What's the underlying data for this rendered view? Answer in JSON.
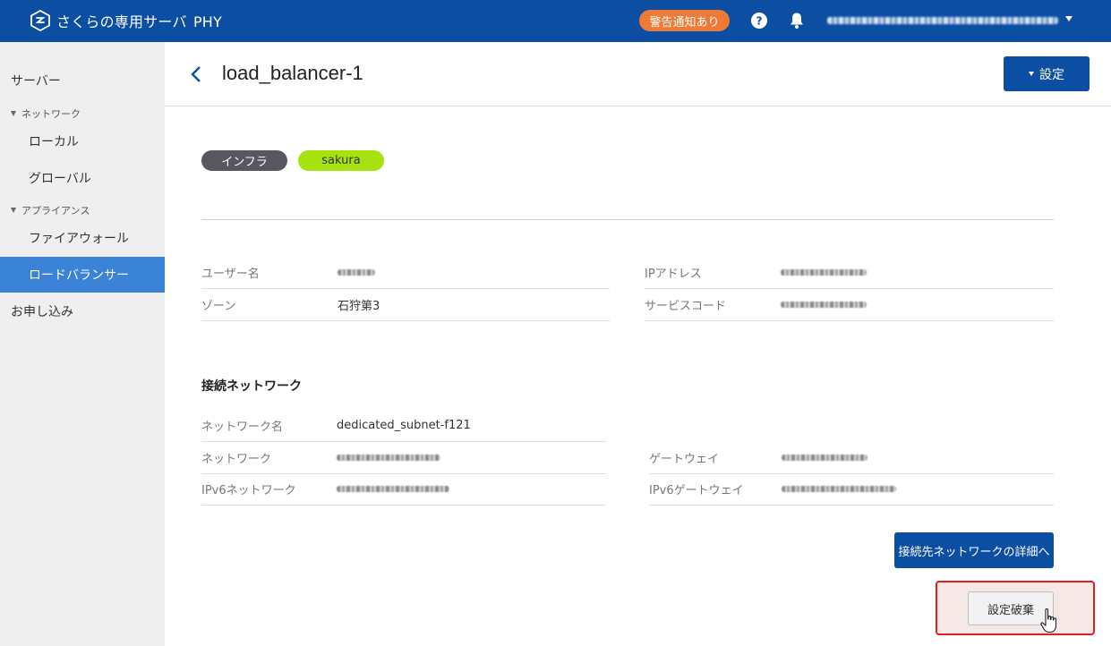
{
  "topbar": {
    "brand": "さくらの専用サーバ",
    "brand_suffix": "PHY",
    "alert_badge": "警告通知あり",
    "icons": [
      "help-icon",
      "bell-icon",
      "caret-down-icon"
    ],
    "colors": {
      "bar": "#0b4ea2",
      "badge": "#ef7a36"
    }
  },
  "sidebar": {
    "server": "サーバー",
    "network_group": "ネットワーク",
    "local": "ローカル",
    "global": "グローバル",
    "appliance_group": "アプライアンス",
    "firewall": "ファイアウォール",
    "load_balancer": "ロードバランサー",
    "apply": "お申し込み",
    "active_color": "#3b83d6"
  },
  "header": {
    "title": "load_balancer-1",
    "settings_button": "設定"
  },
  "tags": {
    "infra": "インフラ",
    "sakura": "sakura",
    "colors": {
      "infra": "#5a5660",
      "sakura": "#a6e20e"
    }
  },
  "info": {
    "username_label": "ユーザー名",
    "zone_label": "ゾーン",
    "zone_value": "石狩第3",
    "ip_label": "IPアドレス",
    "service_code_label": "サービスコード"
  },
  "network": {
    "section_title": "接続ネットワーク",
    "name_label": "ネットワーク名",
    "name_value": "dedicated_subnet-f121",
    "network_label": "ネットワーク",
    "gateway_label": "ゲートウェイ",
    "ipv6_network_label": "IPv6ネットワーク",
    "ipv6_gateway_label": "IPv6ゲートウェイ"
  },
  "buttons": {
    "network_detail": "接続先ネットワークの詳細へ",
    "discard": "設定破棄",
    "highlight_color": "#e02020"
  }
}
